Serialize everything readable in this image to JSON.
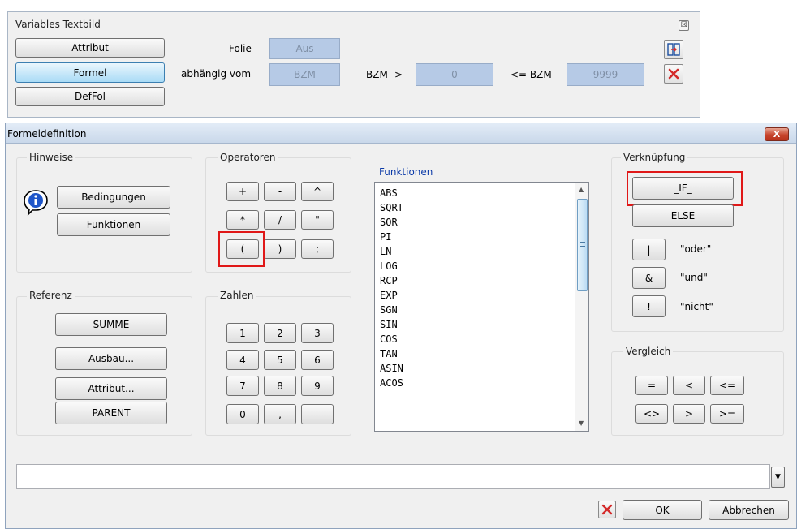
{
  "variables_panel": {
    "title": "Variables Textbild",
    "close_symbol": "☒",
    "buttons": [
      "Attribut",
      "Formel",
      "DefFol"
    ],
    "folie_label": "Folie",
    "folie_value": "Aus",
    "abhaengig_label": "abhängig vom",
    "abhaengig_value": "BZM",
    "bzm_from_label": "BZM ->",
    "bzm_from_value": "0",
    "bzm_to_label": "<= BZM",
    "bzm_to_value": "9999",
    "icons": [
      "split-window-icon",
      "close-x-icon"
    ]
  },
  "dialog": {
    "title": "Formeldefinition",
    "close_label": "X"
  },
  "hinweise": {
    "label": "Hinweise",
    "icon": "info-icon",
    "buttons": [
      "Bedingungen",
      "Funktionen"
    ]
  },
  "operatoren": {
    "label": "Operatoren",
    "buttons": [
      "+",
      "-",
      "^",
      "*",
      "/",
      "\"",
      "(",
      ")",
      ";"
    ]
  },
  "funktionen": {
    "label": "Funktionen",
    "items": [
      "ABS",
      "SQRT",
      "SQR",
      "PI",
      "LN",
      "LOG",
      "RCP",
      "EXP",
      "SGN",
      "SIN",
      "COS",
      "TAN",
      "ASIN",
      "ACOS"
    ]
  },
  "verknuepfung": {
    "label": "Verknüpfung",
    "if_label": "_IF_",
    "else_label": "_ELSE_",
    "ops": [
      {
        "symbol": "|",
        "desc": "\"oder\""
      },
      {
        "symbol": "&",
        "desc": "\"und\""
      },
      {
        "symbol": "!",
        "desc": "\"nicht\""
      }
    ]
  },
  "referenz": {
    "label": "Referenz",
    "buttons": [
      "SUMME",
      "Ausbau...",
      "Attribut...",
      "PARENT"
    ]
  },
  "zahlen": {
    "label": "Zahlen",
    "buttons": [
      "1",
      "2",
      "3",
      "4",
      "5",
      "6",
      "7",
      "8",
      "9",
      "0",
      ",",
      "-"
    ]
  },
  "vergleich": {
    "label": "Vergleich",
    "buttons": [
      "=",
      "<",
      "<=",
      "<>",
      ">",
      ">="
    ]
  },
  "footer": {
    "formula_value": "",
    "ok_label": "OK",
    "cancel_label": "Abbrechen"
  },
  "colors": {
    "accent_red": "#e01818",
    "field_blue": "#b6cae6",
    "active_button": "#a9dbf6"
  }
}
